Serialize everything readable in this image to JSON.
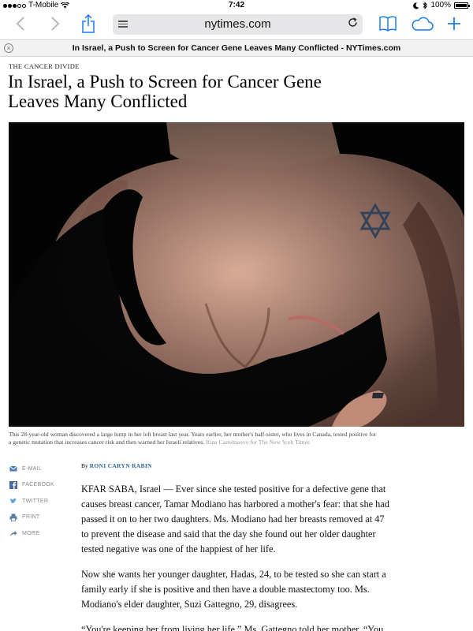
{
  "status_bar": {
    "carrier": "T-Mobile",
    "time": "7:42",
    "battery": "100%"
  },
  "toolbar": {
    "url": "nytimes.com",
    "back_icon": "chevron-left-icon",
    "forward_icon": "chevron-right-icon",
    "share_icon": "share-icon",
    "reader_icon": "reader-icon",
    "reload_icon": "reload-icon",
    "bookmarks_icon": "book-icon",
    "icloud_tabs_icon": "cloud-icon",
    "new_tab_icon": "plus-icon",
    "accent_color": "#1a7cf5"
  },
  "tab": {
    "title": "In Israel, a Push to Screen for Cancer Gene Leaves Many Conflicted - NYTimes.com",
    "close_icon": "close-icon"
  },
  "article": {
    "kicker": "THE CANCER DIVIDE",
    "headline": "In Israel, a Push to Screen for Cancer Gene Leaves Many Conflicted",
    "caption": "This 28-year-old woman discovered a large lump in her left breast last year. Years earlier, her mother's half-sister, who lives in Canada, tested positive for a genetic mutation that increases cancer risk and then warned her Israeli relatives.",
    "photo_credit": "Rina Castelnuovo for The New York Times",
    "byline_prefix": "By",
    "author": "RONI CARYN RABIN",
    "author_color": "#326891",
    "paragraphs": [
      "KFAR SABA, Israel — Ever since she tested positive for a defective gene that causes breast cancer, Tamar Modiano has harbored a mother's fear: that she had passed it on to her two daughters. Ms. Modiano had her breasts removed at 47 to prevent the disease and said that the day she found out her older daughter tested negative was one of the happiest of her life.",
      "Now she wants her younger daughter, Hadas, 24, to be tested so she can start a family early if she is positive and then have a double mastectomy too. Ms. Modiano's elder daughter, Suzi Gattegno, 29, disagrees.",
      "“You're keeping her from living her life,” Ms. Gattegno told her mother. “You want to marry her off early.”"
    ]
  },
  "share": {
    "items": [
      {
        "label": "E-MAIL",
        "icon": "envelope-icon"
      },
      {
        "label": "FACEBOOK",
        "icon": "facebook-icon"
      },
      {
        "label": "TWITTER",
        "icon": "twitter-icon"
      },
      {
        "label": "PRINT",
        "icon": "printer-icon"
      },
      {
        "label": "MORE",
        "icon": "share-arrow-icon"
      }
    ]
  }
}
